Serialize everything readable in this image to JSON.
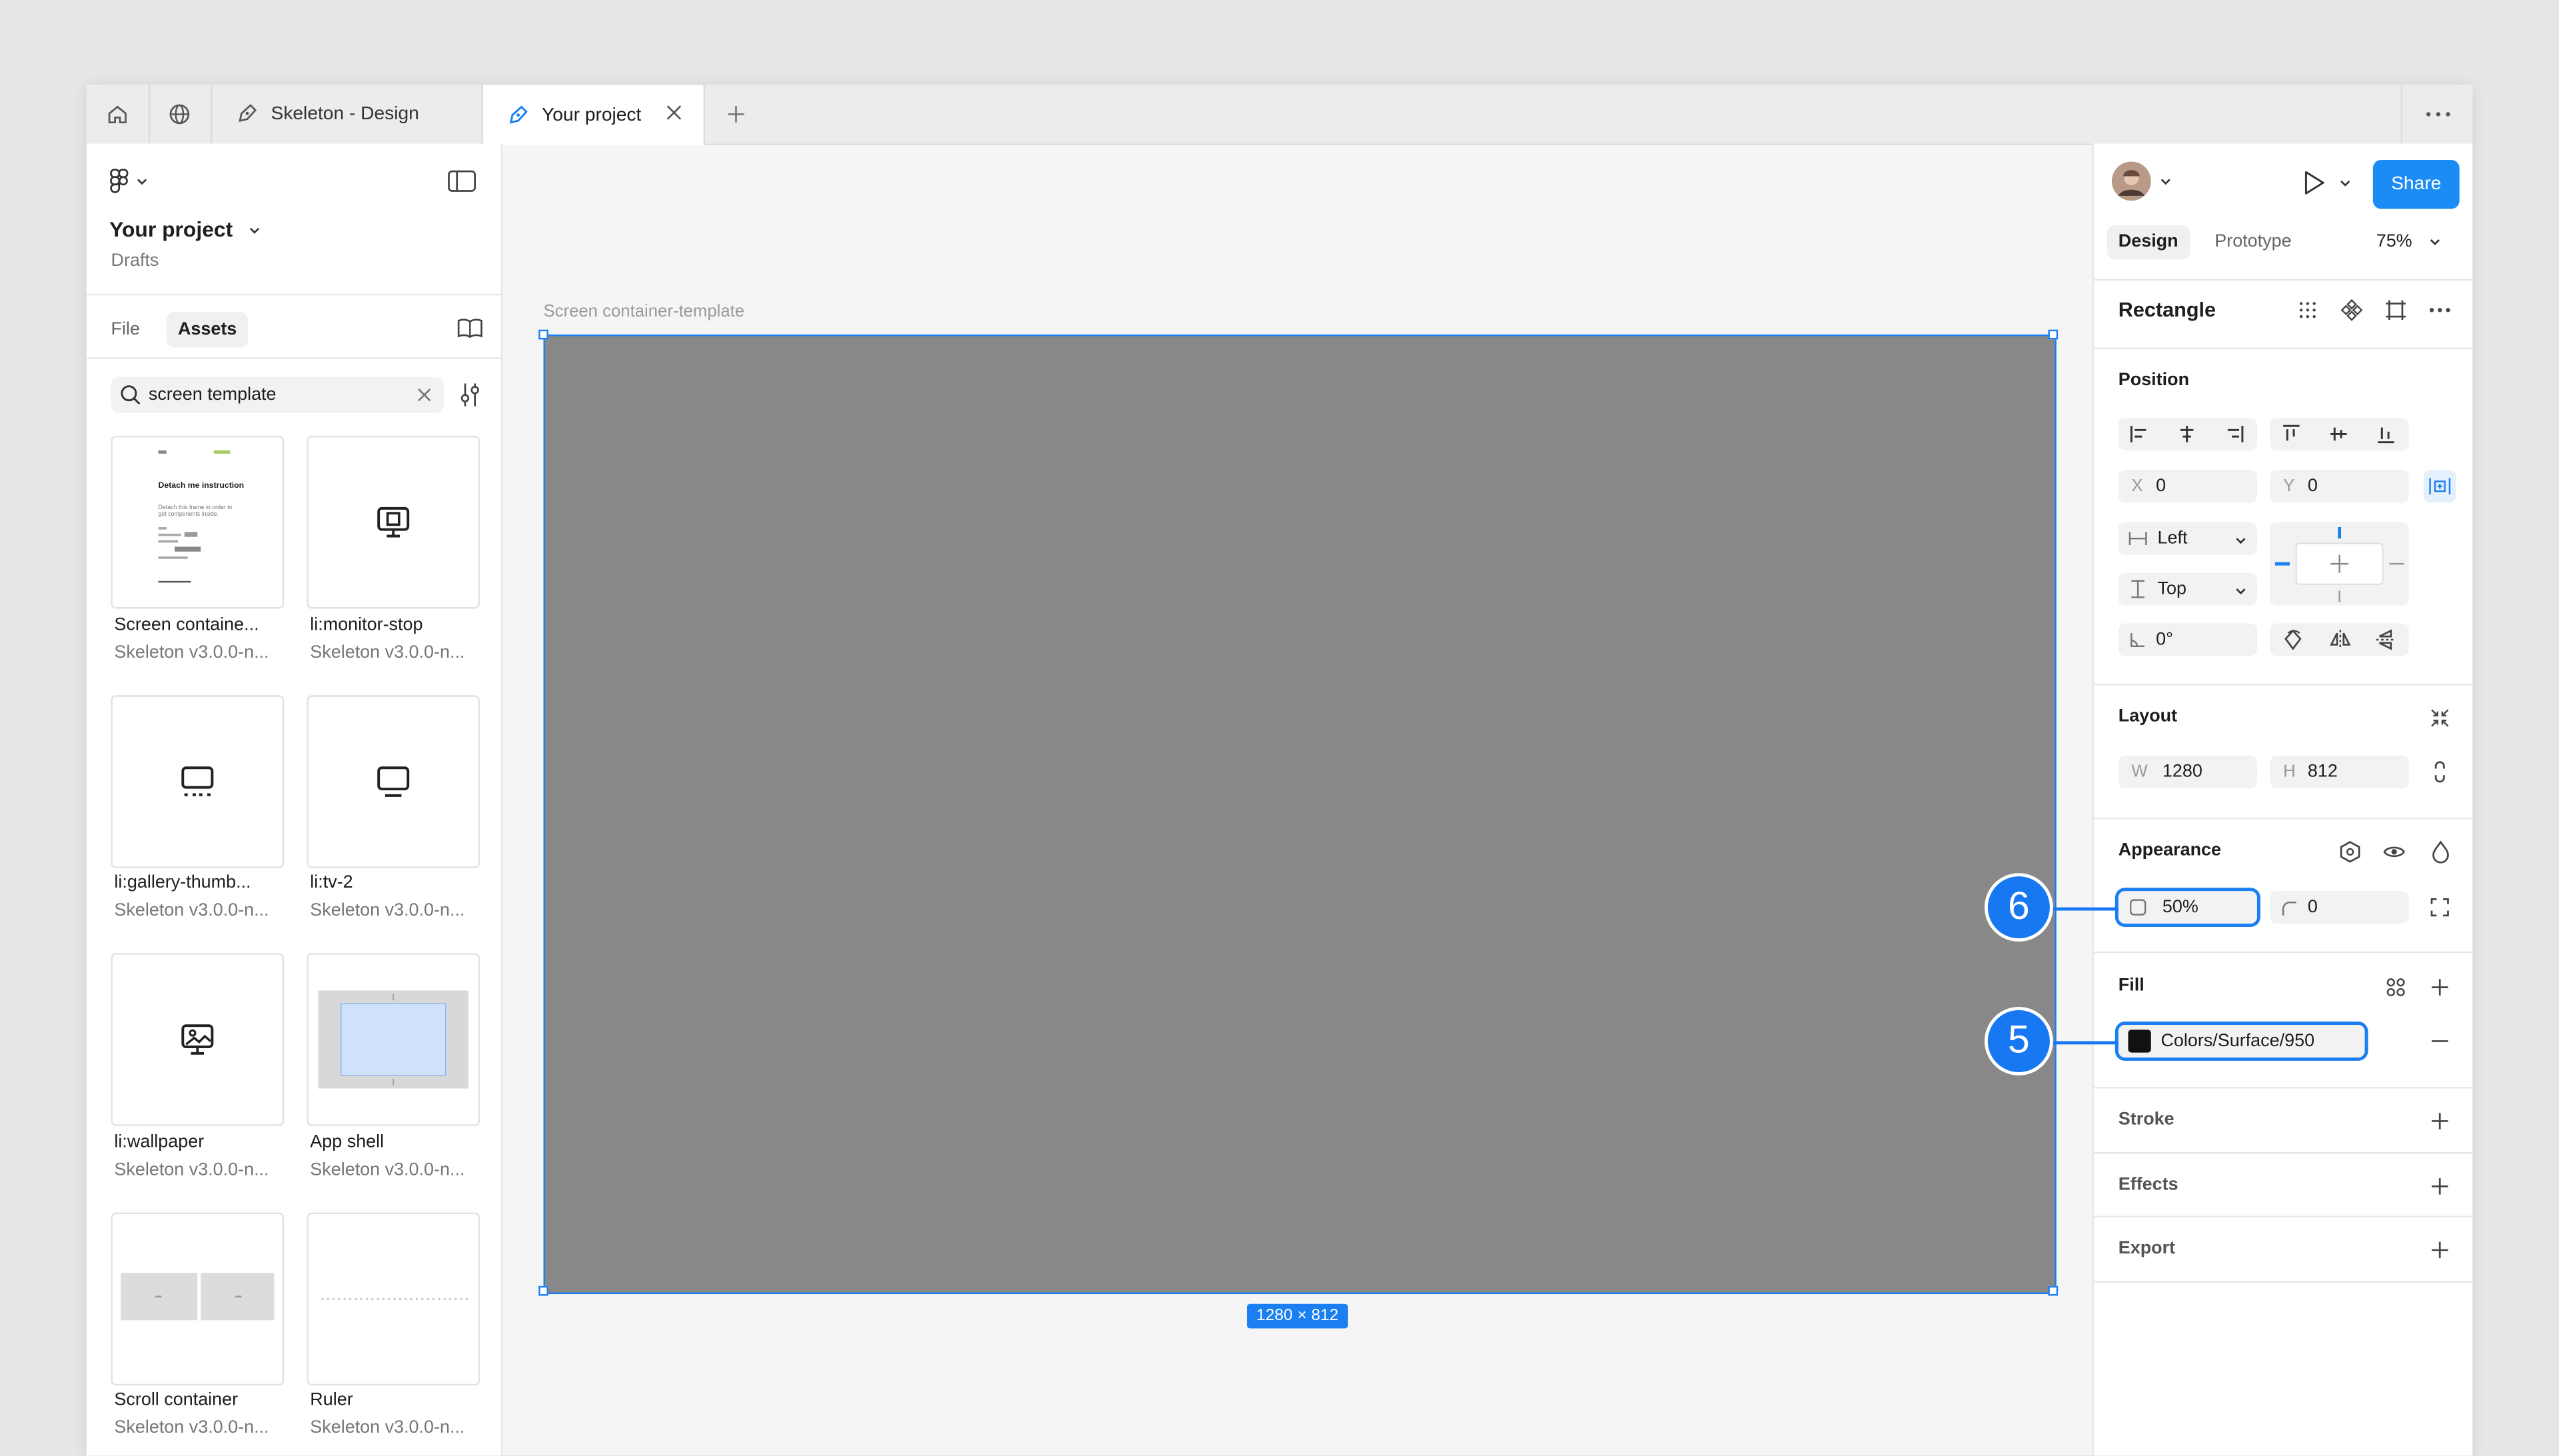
{
  "tabs": [
    {
      "label": "Skeleton - Design"
    },
    {
      "label": "Your project"
    }
  ],
  "left_panel": {
    "project_title": "Your project",
    "project_sub": "Drafts",
    "file_tab": "File",
    "assets_tab": "Assets",
    "search_value": "screen template",
    "assets": [
      {
        "name": "Screen containe...",
        "sub": "Skeleton v3.0.0-n...",
        "thumb_title": "Detach me instruction",
        "thumb_text": "Detach this frame in order to get components inside."
      },
      {
        "name": "li:monitor-stop",
        "sub": "Skeleton v3.0.0-n..."
      },
      {
        "name": "li:gallery-thumb...",
        "sub": "Skeleton v3.0.0-n..."
      },
      {
        "name": "li:tv-2",
        "sub": "Skeleton v3.0.0-n..."
      },
      {
        "name": "li:wallpaper",
        "sub": "Skeleton v3.0.0-n..."
      },
      {
        "name": "App shell",
        "sub": "Skeleton v3.0.0-n..."
      },
      {
        "name": "Scroll container",
        "sub": "Skeleton v3.0.0-n..."
      },
      {
        "name": "Ruler",
        "sub": "Skeleton v3.0.0-n..."
      }
    ]
  },
  "canvas": {
    "frame_label": "Screen container-template",
    "dimension_badge": "1280 × 812"
  },
  "right_panel": {
    "share_label": "Share",
    "design_tab": "Design",
    "prototype_tab": "Prototype",
    "zoom": "75%",
    "layer_name": "Rectangle",
    "position": {
      "title": "Position",
      "x_label": "X",
      "x_value": "0",
      "y_label": "Y",
      "y_value": "0",
      "h_constraint": "Left",
      "v_constraint": "Top",
      "rotation": "0°"
    },
    "layout": {
      "title": "Layout",
      "w_label": "W",
      "w_value": "1280",
      "h_label": "H",
      "h_value": "812"
    },
    "appearance": {
      "title": "Appearance",
      "opacity": "50%",
      "radius": "0"
    },
    "fill": {
      "title": "Fill",
      "style_name": "Colors/Surface/950",
      "swatch_color": "#111111"
    },
    "stroke_title": "Stroke",
    "effects_title": "Effects",
    "export_title": "Export"
  },
  "callouts": {
    "opacity_callout": "6",
    "fill_callout": "5"
  },
  "colors": {
    "accent": "#1b7ff2",
    "frame_fill": "#888888"
  }
}
